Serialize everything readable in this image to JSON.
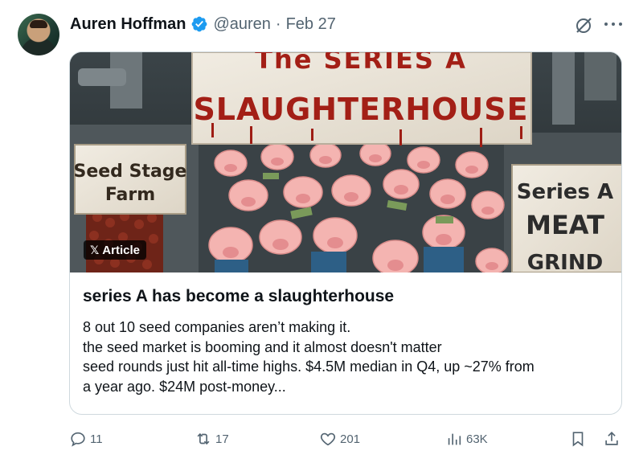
{
  "tweet": {
    "author_name": "Auren Hoffman",
    "handle": "@auren",
    "separator": "·",
    "date": "Feb 27",
    "verified": true
  },
  "card": {
    "badge": "Article",
    "image_texts": {
      "top_sign": "The SERIES A SLAUGHTERHOUSE",
      "left_sign": "Seed Stage Farm",
      "right_sign": "Series A MEAT GRIND"
    },
    "title": "series A has become a slaughterhouse",
    "description_lines": [
      "8 out 10 seed companies aren’t making it.",
      "the seed market is booming and it almost doesn't matter",
      "seed rounds just hit all-time highs. $4.5M median in Q4, up ~27% from",
      "a year ago. $24M post-money..."
    ]
  },
  "actions": {
    "replies": "11",
    "reposts": "17",
    "likes": "201",
    "views": "63K"
  },
  "colors": {
    "accent": "#1d9bf0",
    "muted": "#536471",
    "border": "#cfd9de",
    "sign_red": "#a31f16"
  },
  "icons": [
    "verified-badge-icon",
    "grok-icon",
    "more-icon",
    "x-logo-icon",
    "reply-icon",
    "repost-icon",
    "like-icon",
    "views-icon",
    "bookmark-icon",
    "share-icon"
  ]
}
